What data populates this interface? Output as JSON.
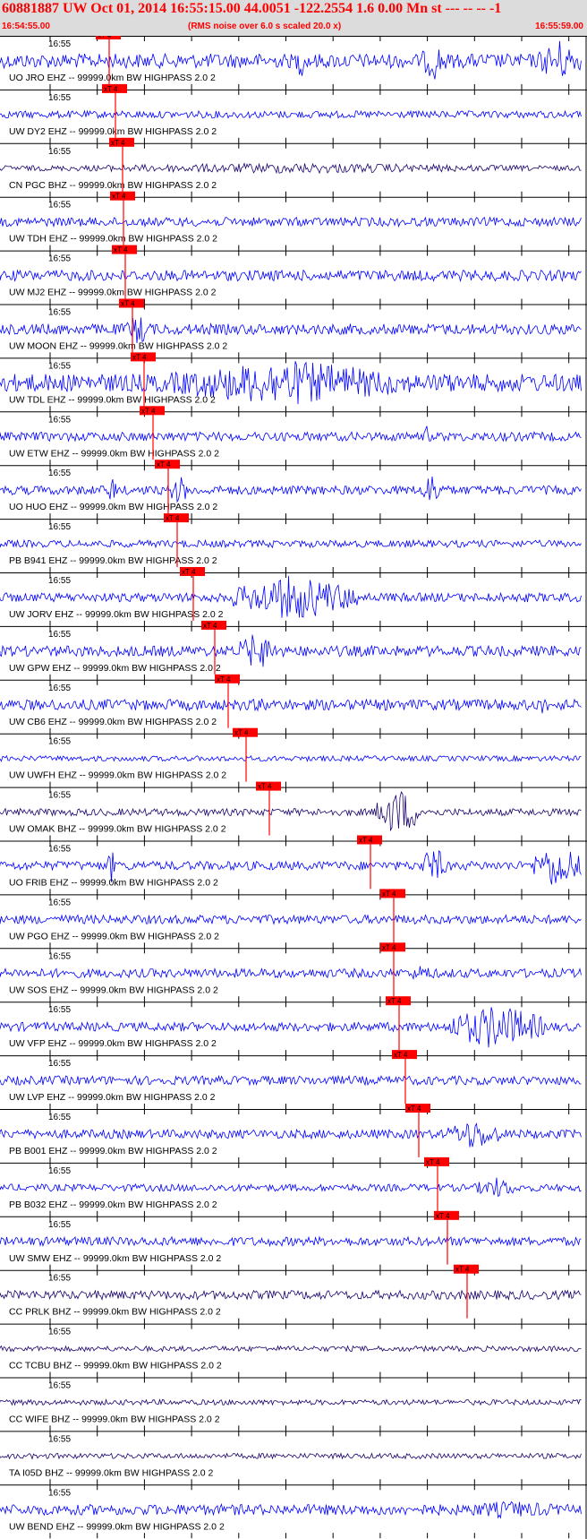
{
  "header": {
    "title": "60881887 UW Oct 01, 2014 16:55:15.00    44.0051 -122.2554  1.6 0.00 Mn st --- -- --  -1",
    "start_time": "16:54:55.00",
    "rms_note": "(RMS noise over 6.0 s scaled 20.0 x)",
    "end_time": "16:55:59.00"
  },
  "time_label": "16:55",
  "pick_label": "xT 4",
  "traces": [
    {
      "label": "UO JRO EHZ -- 99999.0km BW  HIGHPASS  2.0  2",
      "color": "#0000ff"
    },
    {
      "label": "UW DY2 EHZ -- 99999.0km BW  HIGHPASS  2.0  2",
      "color": "#0000ff"
    },
    {
      "label": "CN PGC BHZ -- 99999.0km BW  HIGHPASS  2.0  2",
      "color": "#1a006b"
    },
    {
      "label": "UW TDH EHZ -- 99999.0km BW  HIGHPASS  2.0  2",
      "color": "#0000ff"
    },
    {
      "label": "UW MJ2 EHZ -- 99999.0km BW  HIGHPASS  2.0  2",
      "color": "#0000ff"
    },
    {
      "label": "UW MOON EHZ -- 99999.0km BW  HIGHPASS  2.0  2",
      "color": "#0000ff"
    },
    {
      "label": "UW TDL EHZ -- 99999.0km BW  HIGHPASS  2.0  2",
      "color": "#0000ff"
    },
    {
      "label": "UW ETW EHZ -- 99999.0km BW  HIGHPASS  2.0  2",
      "color": "#0000ff"
    },
    {
      "label": "UO HUO EHZ -- 99999.0km BW  HIGHPASS  2.0  2",
      "color": "#0000ff"
    },
    {
      "label": "PB B941 EHZ -- 99999.0km BW  HIGHPASS  2.0  2",
      "color": "#0000ff"
    },
    {
      "label": "UW JORV EHZ -- 99999.0km BW  HIGHPASS  2.0  2",
      "color": "#0000ff"
    },
    {
      "label": "UW GPW EHZ -- 99999.0km BW  HIGHPASS  2.0  2",
      "color": "#0000ff"
    },
    {
      "label": "UW CB6 EHZ -- 99999.0km BW  HIGHPASS  2.0  2",
      "color": "#0000ff"
    },
    {
      "label": "UW UWFH EHZ -- 99999.0km BW  HIGHPASS  2.0  2",
      "color": "#0000ff"
    },
    {
      "label": "UW OMAK BHZ -- 99999.0km BW  HIGHPASS  2.0  2",
      "color": "#1a006b"
    },
    {
      "label": "UO FRIB EHZ -- 99999.0km BW  HIGHPASS  2.0  2",
      "color": "#0000ff"
    },
    {
      "label": "UW PGO EHZ -- 99999.0km BW  HIGHPASS  2.0  2",
      "color": "#0000ff"
    },
    {
      "label": "UW SOS EHZ -- 99999.0km BW  HIGHPASS  2.0  2",
      "color": "#0000ff"
    },
    {
      "label": "UW VFP EHZ -- 99999.0km BW  HIGHPASS  2.0  2",
      "color": "#0000ff"
    },
    {
      "label": "UW LVP EHZ -- 99999.0km BW  HIGHPASS  2.0  2",
      "color": "#0000ff"
    },
    {
      "label": "PB B001 EHZ -- 99999.0km BW  HIGHPASS  2.0  2",
      "color": "#0000ff"
    },
    {
      "label": "PB B032 EHZ -- 99999.0km BW  HIGHPASS  2.0  2",
      "color": "#0000ff"
    },
    {
      "label": "UW SMW EHZ -- 99999.0km BW  HIGHPASS  2.0  2",
      "color": "#0000ff"
    },
    {
      "label": "CC PRLK BHZ -- 99999.0km BW  HIGHPASS  2.0  2",
      "color": "#1a006b"
    },
    {
      "label": "CC TCBU BHZ -- 99999.0km BW  HIGHPASS  2.0  2",
      "color": "#1a006b"
    },
    {
      "label": "CC WIFE BHZ -- 99999.0km BW  HIGHPASS  2.0  2",
      "color": "#1a006b"
    },
    {
      "label": "TA I05D BHZ -- 99999.0km BW  HIGHPASS  2.0  2",
      "color": "#1a006b"
    },
    {
      "label": "UW BEND EHZ -- 99999.0km BW  HIGHPASS  2.0  2",
      "color": "#0000ff"
    }
  ],
  "colors": {
    "header_text": "#ff0000",
    "header_bg": "#dcdcdc",
    "pick": "#ff0000",
    "grid": "#000000"
  }
}
